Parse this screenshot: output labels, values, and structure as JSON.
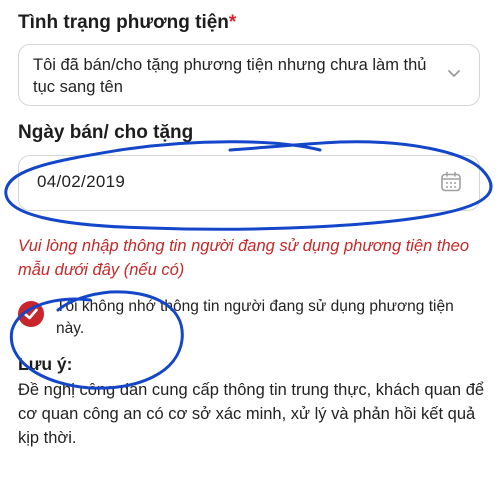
{
  "vehicle_status": {
    "label": "Tình trạng phương tiện",
    "required_mark": "*",
    "selected_value": "Tôi đã bán/cho tặng phương tiện nhưng chưa làm thủ tục sang tên"
  },
  "sale_date": {
    "label": "Ngày bán/ cho tặng",
    "value": "04/02/2019"
  },
  "error_message": "Vui lòng nhập thông tin người đang sử dụng phương tiện theo mẫu dưới đây (nếu có)",
  "unknown_user_checkbox": {
    "checked": true,
    "label": "Tôi không nhớ thông tin người đang sử dụng phương tiện này."
  },
  "note": {
    "title": "Lưu ý:",
    "body": "Đề nghị công dân cung cấp thông tin trung thực, khách quan để cơ quan công an có cơ sở xác minh, xử lý và phản hồi kết quả kịp thời."
  },
  "colors": {
    "accent_red": "#c9252c",
    "error_text": "#c62828",
    "annotation_blue": "#1346c8",
    "border": "#d5d5d5"
  },
  "icons": [
    "chevron-down-icon",
    "calendar-icon",
    "checkmark-icon"
  ]
}
